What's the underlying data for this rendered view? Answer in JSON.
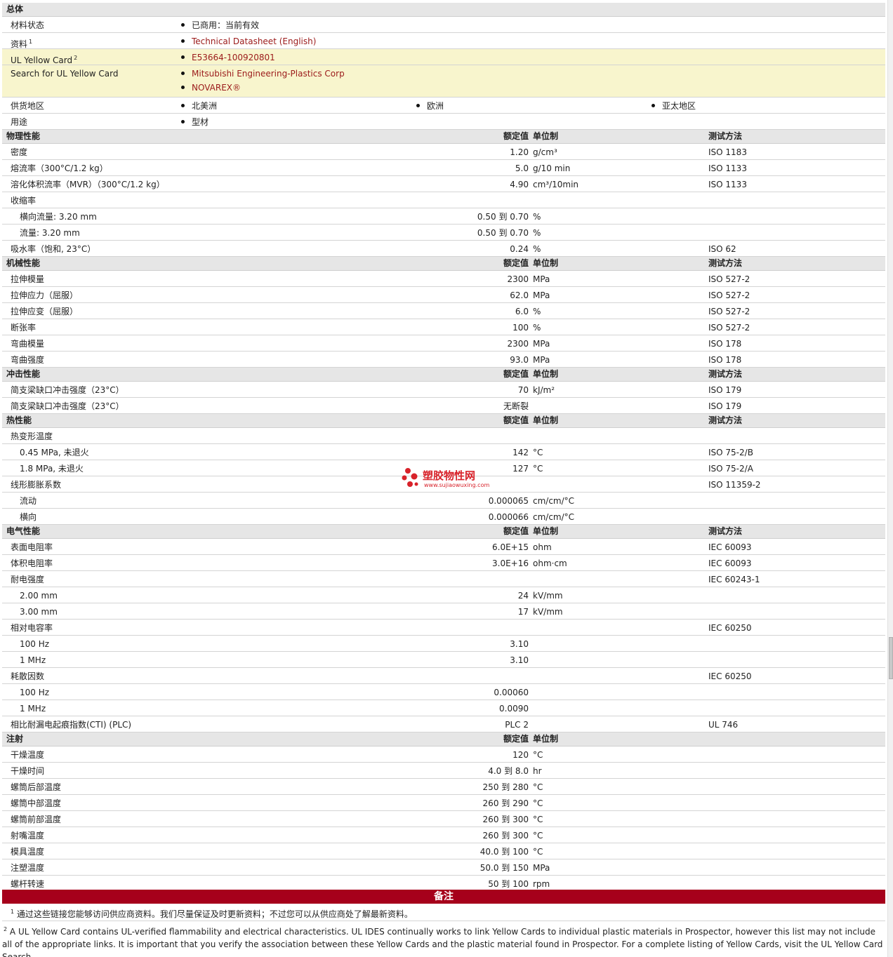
{
  "general": {
    "title": "总体",
    "rows": [
      {
        "label": "材料状态",
        "values": [
          "已商用：当前有效"
        ]
      },
      {
        "label": "资料",
        "sup": "1",
        "values": [
          "Technical Datasheet (English)"
        ],
        "link": true
      },
      {
        "label": "UL Yellow Card",
        "sup": "2",
        "values": [
          "E53664-100920801"
        ],
        "link": true,
        "highlight": true
      },
      {
        "label": "Search for UL Yellow Card",
        "values": [
          "Mitsubishi Engineering-Plastics Corp",
          "NOVAREX®"
        ],
        "link": true,
        "highlight": true
      },
      {
        "label": "供货地区",
        "values": [
          "北美洲",
          "欧洲",
          "亚太地区"
        ],
        "columns": true
      },
      {
        "label": "用途",
        "values": [
          "型材"
        ]
      }
    ]
  },
  "headers": {
    "nominal": "额定值",
    "unit": "单位制",
    "method": "测试方法"
  },
  "sections": [
    {
      "title": "物理性能",
      "rows": [
        {
          "label": "密度",
          "value": "1.20",
          "unit": "g/cm³",
          "method": "ISO 1183"
        },
        {
          "label": "熔流率（300°C/1.2 kg）",
          "value": "5.0",
          "unit": "g/10 min",
          "method": "ISO 1133"
        },
        {
          "label": "溶化体积流率（MVR）（300°C/1.2 kg）",
          "value": "4.90",
          "unit": "cm³/10min",
          "method": "ISO 1133"
        },
        {
          "label": "收缩率",
          "value": "",
          "unit": "",
          "method": ""
        },
        {
          "label": "横向流量: 3.20 mm",
          "indent": true,
          "value": "0.50 到  0.70",
          "unit": "%",
          "method": ""
        },
        {
          "label": "流量: 3.20 mm",
          "indent": true,
          "value": "0.50 到  0.70",
          "unit": "%",
          "method": ""
        },
        {
          "label": "吸水率（饱和, 23°C）",
          "value": "0.24",
          "unit": "%",
          "method": "ISO 62"
        }
      ]
    },
    {
      "title": "机械性能",
      "rows": [
        {
          "label": "拉伸模量",
          "value": "2300",
          "unit": "MPa",
          "method": "ISO 527-2"
        },
        {
          "label": "拉伸应力（屈服）",
          "value": "62.0",
          "unit": "MPa",
          "method": "ISO 527-2"
        },
        {
          "label": "拉伸应变（屈服）",
          "value": "6.0",
          "unit": "%",
          "method": "ISO 527-2"
        },
        {
          "label": "断张率",
          "value": "100",
          "unit": "%",
          "method": "ISO 527-2"
        },
        {
          "label": "弯曲模量",
          "value": "2300",
          "unit": "MPa",
          "method": "ISO 178"
        },
        {
          "label": "弯曲强度",
          "value": "93.0",
          "unit": "MPa",
          "method": "ISO 178"
        }
      ]
    },
    {
      "title": "冲击性能",
      "rows": [
        {
          "label": "简支梁缺口冲击强度（23°C）",
          "value": "70",
          "unit": "kJ/m²",
          "method": "ISO 179"
        },
        {
          "label": "简支梁缺口冲击强度（23°C）",
          "value": "无断裂",
          "unit": "",
          "method": "ISO 179"
        }
      ]
    },
    {
      "title": "热性能",
      "rows": [
        {
          "label": "热变形温度",
          "value": "",
          "unit": "",
          "method": ""
        },
        {
          "label": "0.45 MPa, 未退火",
          "indent": true,
          "value": "142",
          "unit": "°C",
          "method": "ISO 75-2/B"
        },
        {
          "label": "1.8 MPa, 未退火",
          "indent": true,
          "value": "127",
          "unit": "°C",
          "method": "ISO 75-2/A"
        },
        {
          "label": "线形膨胀系数",
          "value": "",
          "unit": "",
          "method": "ISO 11359-2"
        },
        {
          "label": "流动",
          "indent": true,
          "value": "0.000065",
          "unit": "cm/cm/°C",
          "method": ""
        },
        {
          "label": "横向",
          "indent": true,
          "value": "0.000066",
          "unit": "cm/cm/°C",
          "method": ""
        }
      ]
    },
    {
      "title": "电气性能",
      "rows": [
        {
          "label": "表面电阻率",
          "value": "6.0E+15",
          "unit": "ohm",
          "method": "IEC 60093"
        },
        {
          "label": "体积电阻率",
          "value": "3.0E+16",
          "unit": "ohm·cm",
          "method": "IEC 60093"
        },
        {
          "label": "耐电强度",
          "value": "",
          "unit": "",
          "method": "IEC 60243-1"
        },
        {
          "label": "2.00 mm",
          "indent": true,
          "value": "24",
          "unit": "kV/mm",
          "method": ""
        },
        {
          "label": "3.00 mm",
          "indent": true,
          "value": "17",
          "unit": "kV/mm",
          "method": ""
        },
        {
          "label": "相对电容率",
          "value": "",
          "unit": "",
          "method": "IEC 60250"
        },
        {
          "label": "100 Hz",
          "indent": true,
          "value": "3.10",
          "unit": "",
          "method": ""
        },
        {
          "label": "1 MHz",
          "indent": true,
          "value": "3.10",
          "unit": "",
          "method": ""
        },
        {
          "label": "耗散因数",
          "value": "",
          "unit": "",
          "method": "IEC 60250"
        },
        {
          "label": "100 Hz",
          "indent": true,
          "value": "0.00060",
          "unit": "",
          "method": ""
        },
        {
          "label": "1 MHz",
          "indent": true,
          "value": "0.0090",
          "unit": "",
          "method": ""
        },
        {
          "label": "相比耐漏电起痕指数(CTI) (PLC)",
          "value": "PLC 2",
          "unit": "",
          "method": "UL 746"
        }
      ]
    },
    {
      "title": "注射",
      "noMethodHeader": true,
      "rows": [
        {
          "label": "干燥温度",
          "value": "120",
          "unit": "°C",
          "method": ""
        },
        {
          "label": "干燥时间",
          "value": "4.0 到  8.0",
          "unit": "hr",
          "method": ""
        },
        {
          "label": "螺筒后部温度",
          "value": "250 到  280",
          "unit": "°C",
          "method": ""
        },
        {
          "label": "螺筒中部温度",
          "value": "260 到  290",
          "unit": "°C",
          "method": ""
        },
        {
          "label": "螺筒前部温度",
          "value": "260 到  300",
          "unit": "°C",
          "method": ""
        },
        {
          "label": "射嘴温度",
          "value": "260 到  300",
          "unit": "°C",
          "method": ""
        },
        {
          "label": "模具温度",
          "value": "40.0 到  100",
          "unit": "°C",
          "method": ""
        },
        {
          "label": "注塑温度",
          "value": "50.0 到  150",
          "unit": "MPa",
          "method": ""
        },
        {
          "label": "螺杆转速",
          "value": "50 到  100",
          "unit": "rpm",
          "method": ""
        }
      ]
    }
  ],
  "notes": {
    "title": "备注",
    "items": [
      {
        "num": "1",
        "text": "通过这些链接您能够访问供应商资料。我们尽量保证及时更新资料；不过您可以从供应商处了解最新资料。"
      },
      {
        "num": "2",
        "text": "A UL Yellow Card contains UL-verified flammability and electrical characteristics. UL IDES continually works to link Yellow Cards to individual plastic materials in Prospector, however this list may not include all of the appropriate links. It is important that you verify the association between these Yellow Cards and the plastic material found in Prospector. For a complete listing of Yellow Cards, visit the UL Yellow Card Search."
      }
    ]
  },
  "watermark": {
    "title": "塑胶物性网",
    "url": "www.sujiaowuxing.com",
    "color": "#d8222a"
  },
  "colors": {
    "section_bg": "#e6e6e6",
    "highlight_bg": "#f8f5cd",
    "link": "#9b1a1a",
    "notes_bar": "#a6001b"
  }
}
